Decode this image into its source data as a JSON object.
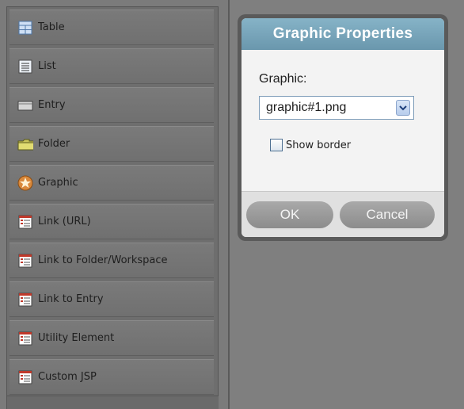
{
  "palette": {
    "items": [
      {
        "label": "Table",
        "icon": "table-icon"
      },
      {
        "label": "List",
        "icon": "list-icon"
      },
      {
        "label": "Entry",
        "icon": "entry-icon"
      },
      {
        "label": "Folder",
        "icon": "folder-icon"
      },
      {
        "label": "Graphic",
        "icon": "graphic-icon"
      },
      {
        "label": "Link (URL)",
        "icon": "link-url-icon"
      },
      {
        "label": "Link to Folder/Workspace",
        "icon": "link-folder-icon"
      },
      {
        "label": "Link to Entry",
        "icon": "link-entry-icon"
      },
      {
        "label": "Utility Element",
        "icon": "utility-icon"
      },
      {
        "label": "Custom JSP",
        "icon": "custom-jsp-icon"
      }
    ]
  },
  "dialog": {
    "title": "Graphic Properties",
    "graphic_label": "Graphic:",
    "graphic_value": "graphic#1.png",
    "show_border_label": "Show border",
    "show_border_checked": false,
    "ok_label": "OK",
    "cancel_label": "Cancel"
  },
  "colors": {
    "title_bar": "#7aa7bc",
    "background": "#7b7b7b"
  }
}
